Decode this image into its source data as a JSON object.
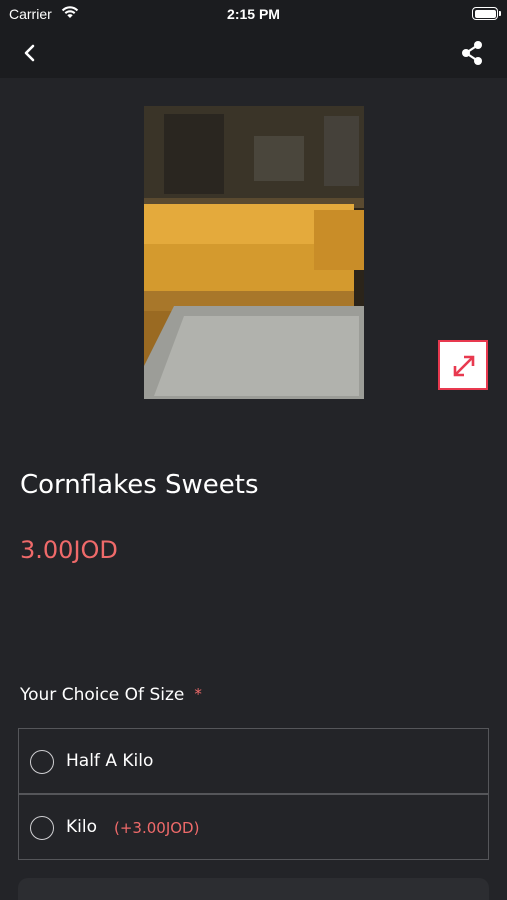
{
  "status_bar": {
    "carrier": "Carrier",
    "time": "2:15 PM",
    "wifi_icon": "wifi-icon",
    "battery_icon": "battery-icon"
  },
  "nav": {
    "back_icon": "chevron-left-icon",
    "share_icon": "share-icon"
  },
  "product": {
    "name": "Cornflakes Sweets",
    "price": "3.00JOD",
    "expand_icon": "expand-icon"
  },
  "size_choice": {
    "heading": "Your Choice Of Size",
    "required_mark": "*",
    "options": [
      {
        "label": "Half A Kilo",
        "extra": ""
      },
      {
        "label": "Kilo",
        "extra": "(+3.00JOD)"
      }
    ]
  },
  "colors": {
    "background": "#232428",
    "bar_background": "#1b1c1f",
    "accent": "#ef6a6a",
    "expand_border": "#e8394f"
  }
}
